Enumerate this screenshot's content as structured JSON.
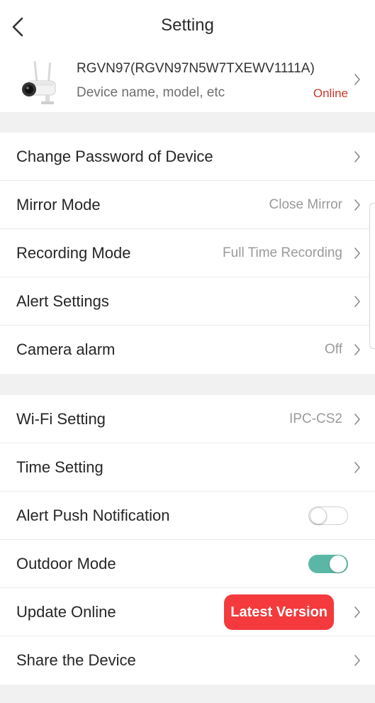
{
  "header": {
    "title": "Setting",
    "back_icon": "chevron-left-icon"
  },
  "device": {
    "name": "RGVN97(RGVN97N5W7TXEWV1111A)",
    "subtitle": "Device name, model, etc",
    "status": "Online",
    "status_color": "#c8382c",
    "thumbnail_icon": "camera-icon"
  },
  "group1": {
    "items": [
      {
        "label": "Change Password of Device",
        "value": ""
      },
      {
        "label": "Mirror Mode",
        "value": "Close Mirror"
      },
      {
        "label": "Recording Mode",
        "value": "Full Time Recording"
      },
      {
        "label": "Alert Settings",
        "value": ""
      },
      {
        "label": "Camera alarm",
        "value": "Off"
      }
    ]
  },
  "group2": {
    "items": [
      {
        "label": "Wi-Fi Setting",
        "value": "IPC-CS2"
      },
      {
        "label": "Time Setting",
        "value": ""
      },
      {
        "label": "Alert Push Notification",
        "toggle": false
      },
      {
        "label": "Outdoor Mode",
        "toggle": true
      },
      {
        "label": "Update Online",
        "badge": "Latest Version"
      },
      {
        "label": "Share the Device",
        "value": ""
      }
    ]
  },
  "colors": {
    "toggle_on": "#5ab7a5",
    "badge": "#f43a3d",
    "background": "#f1f1f1"
  }
}
